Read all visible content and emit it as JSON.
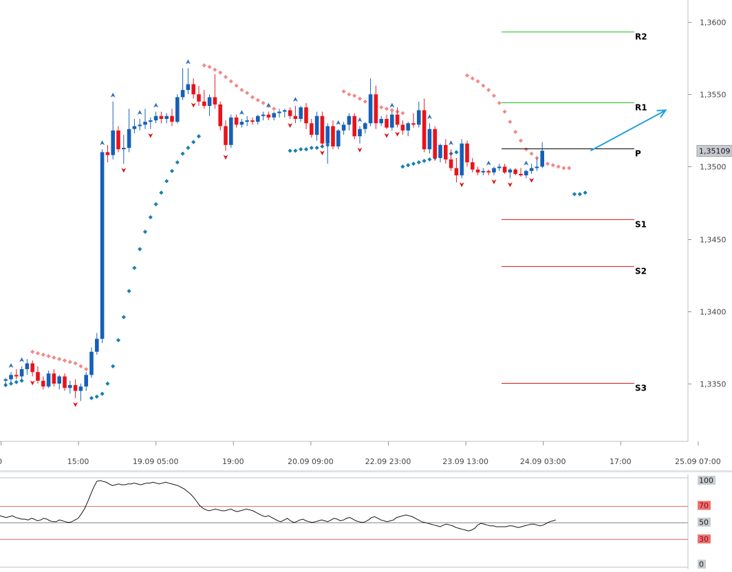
{
  "chart_data": [
    {
      "type": "candlestick",
      "x_ticks": [
        "0",
        "15:00",
        "19.09 05:00",
        "19:00",
        "20.09 09:00",
        "22.09 23:00",
        "23.09 13:00",
        "24.09 03:00",
        "17:00",
        "25.09 07:00"
      ],
      "y_ticks": [
        "1,3350",
        "1,3400",
        "1,3450",
        "1,3500",
        "1,3550",
        "1,3600"
      ],
      "ylim": [
        1.3318,
        1.3615
      ],
      "current_price": 1.35109,
      "current_price_label": "1,35109",
      "colors": {
        "bull": "#1560b8",
        "bear": "#e8141c",
        "sar_above": "#f08a8a",
        "sar_below": "#1a7fb0",
        "projection": "#1ea0dc"
      },
      "candles": [
        [
          1.3352,
          1.3354,
          1.3348,
          1.3353
        ],
        [
          1.3353,
          1.3358,
          1.3351,
          1.3356
        ],
        [
          1.3356,
          1.336,
          1.3353,
          1.3355
        ],
        [
          1.3355,
          1.3362,
          1.3352,
          1.336
        ],
        [
          1.336,
          1.3367,
          1.3356,
          1.3364
        ],
        [
          1.3364,
          1.3366,
          1.3355,
          1.3358
        ],
        [
          1.3358,
          1.3362,
          1.335,
          1.3352
        ],
        [
          1.3352,
          1.3355,
          1.3346,
          1.3348
        ],
        [
          1.3348,
          1.3359,
          1.3347,
          1.3357
        ],
        [
          1.3357,
          1.336,
          1.3348,
          1.335
        ],
        [
          1.335,
          1.3356,
          1.3346,
          1.3355
        ],
        [
          1.3355,
          1.3357,
          1.3345,
          1.3347
        ],
        [
          1.3347,
          1.3352,
          1.3343,
          1.3349
        ],
        [
          1.3349,
          1.3353,
          1.334,
          1.3345
        ],
        [
          1.3345,
          1.335,
          1.3338,
          1.3348
        ],
        [
          1.3348,
          1.3358,
          1.3345,
          1.3356
        ],
        [
          1.3356,
          1.3375,
          1.3354,
          1.3372
        ],
        [
          1.3372,
          1.3385,
          1.337,
          1.3381
        ],
        [
          1.3381,
          1.3512,
          1.3378,
          1.351
        ],
        [
          1.351,
          1.3515,
          1.3503,
          1.3508
        ],
        [
          1.3508,
          1.3545,
          1.3505,
          1.3525
        ],
        [
          1.3525,
          1.3528,
          1.351,
          1.3512
        ],
        [
          1.3512,
          1.3522,
          1.3502,
          1.3513
        ],
        [
          1.3513,
          1.354,
          1.351,
          1.3526
        ],
        [
          1.3526,
          1.3533,
          1.3523,
          1.3528
        ],
        [
          1.3528,
          1.3533,
          1.3525,
          1.3529
        ],
        [
          1.3529,
          1.354,
          1.3526,
          1.3531
        ],
        [
          1.3531,
          1.3534,
          1.3526,
          1.3532
        ],
        [
          1.3532,
          1.3538,
          1.353,
          1.3535
        ],
        [
          1.3535,
          1.3538,
          1.353,
          1.3533
        ],
        [
          1.3533,
          1.3537,
          1.353,
          1.3535
        ],
        [
          1.3535,
          1.354,
          1.3528,
          1.3531
        ],
        [
          1.3531,
          1.355,
          1.353,
          1.3548
        ],
        [
          1.3548,
          1.3568,
          1.3546,
          1.3553
        ],
        [
          1.3553,
          1.3568,
          1.355,
          1.3557
        ],
        [
          1.3557,
          1.3561,
          1.3547,
          1.355
        ],
        [
          1.355,
          1.3556,
          1.3542,
          1.3545
        ],
        [
          1.3545,
          1.3553,
          1.354,
          1.3542
        ],
        [
          1.3542,
          1.355,
          1.3535,
          1.3548
        ],
        [
          1.3548,
          1.3564,
          1.354,
          1.3543
        ],
        [
          1.3543,
          1.3545,
          1.3525,
          1.3528
        ],
        [
          1.3528,
          1.3532,
          1.3511,
          1.3515
        ],
        [
          1.3515,
          1.3536,
          1.3513,
          1.3534
        ],
        [
          1.3534,
          1.3536,
          1.3527,
          1.3529
        ],
        [
          1.3529,
          1.3533,
          1.3527,
          1.3531
        ],
        [
          1.3531,
          1.3535,
          1.3528,
          1.3532
        ],
        [
          1.3532,
          1.3534,
          1.3529,
          1.3531
        ],
        [
          1.3531,
          1.3536,
          1.3529,
          1.3535
        ],
        [
          1.3535,
          1.3538,
          1.3532,
          1.3536
        ],
        [
          1.3536,
          1.3538,
          1.3532,
          1.3534
        ],
        [
          1.3534,
          1.3538,
          1.3532,
          1.3537
        ],
        [
          1.3537,
          1.354,
          1.3534,
          1.3538
        ],
        [
          1.3538,
          1.354,
          1.3534,
          1.3539
        ],
        [
          1.3539,
          1.3541,
          1.3533,
          1.3535
        ],
        [
          1.3535,
          1.3542,
          1.353,
          1.3533
        ],
        [
          1.3533,
          1.3542,
          1.3531,
          1.3541
        ],
        [
          1.3541,
          1.3544,
          1.3526,
          1.353
        ],
        [
          1.353,
          1.3533,
          1.352,
          1.3522
        ],
        [
          1.3522,
          1.3538,
          1.3518,
          1.3535
        ],
        [
          1.3535,
          1.3538,
          1.3514,
          1.3516
        ],
        [
          1.3516,
          1.353,
          1.3502,
          1.3528
        ],
        [
          1.3528,
          1.3532,
          1.3512,
          1.3514
        ],
        [
          1.3514,
          1.3526,
          1.3512,
          1.3525
        ],
        [
          1.3525,
          1.3531,
          1.3522,
          1.3529
        ],
        [
          1.3529,
          1.3537,
          1.3525,
          1.3535
        ],
        [
          1.3535,
          1.3537,
          1.3519,
          1.3521
        ],
        [
          1.3521,
          1.3528,
          1.3516,
          1.3526
        ],
        [
          1.3526,
          1.3531,
          1.3523,
          1.353
        ],
        [
          1.353,
          1.3561,
          1.3528,
          1.355
        ],
        [
          1.355,
          1.3556,
          1.3526,
          1.353
        ],
        [
          1.353,
          1.3535,
          1.3528,
          1.3533
        ],
        [
          1.3533,
          1.3536,
          1.3526,
          1.3527
        ],
        [
          1.3527,
          1.3538,
          1.3525,
          1.3536
        ],
        [
          1.3536,
          1.3541,
          1.3527,
          1.3529
        ],
        [
          1.3529,
          1.3532,
          1.3522,
          1.3525
        ],
        [
          1.3525,
          1.3531,
          1.3521,
          1.353
        ],
        [
          1.353,
          1.3537,
          1.3527,
          1.3529
        ],
        [
          1.3529,
          1.3545,
          1.3527,
          1.3539
        ],
        [
          1.3539,
          1.3547,
          1.351,
          1.3512
        ],
        [
          1.3512,
          1.353,
          1.3509,
          1.3526
        ],
        [
          1.3526,
          1.3528,
          1.3504,
          1.3506
        ],
        [
          1.3506,
          1.3516,
          1.3503,
          1.3515
        ],
        [
          1.3515,
          1.3519,
          1.3502,
          1.3505
        ],
        [
          1.3505,
          1.3512,
          1.3497,
          1.3499
        ],
        [
          1.3499,
          1.3506,
          1.3489,
          1.3494
        ],
        [
          1.3494,
          1.3519,
          1.3492,
          1.3516
        ],
        [
          1.3516,
          1.3518,
          1.35,
          1.3503
        ],
        [
          1.3503,
          1.3506,
          1.3496,
          1.3498
        ],
        [
          1.3498,
          1.35,
          1.3494,
          1.3496
        ],
        [
          1.3496,
          1.3499,
          1.3494,
          1.3497
        ],
        [
          1.3497,
          1.3498,
          1.3494,
          1.3496
        ],
        [
          1.3496,
          1.35,
          1.3494,
          1.3499
        ],
        [
          1.3499,
          1.3502,
          1.3497,
          1.35
        ],
        [
          1.35,
          1.3502,
          1.3495,
          1.3496
        ],
        [
          1.3496,
          1.3499,
          1.3492,
          1.3498
        ],
        [
          1.3498,
          1.3499,
          1.3494,
          1.3495
        ],
        [
          1.3495,
          1.3499,
          1.3493,
          1.3494
        ],
        [
          1.3494,
          1.3498,
          1.3492,
          1.3497
        ],
        [
          1.3497,
          1.3502,
          1.3495,
          1.3499
        ],
        [
          1.3499,
          1.3506,
          1.3497,
          1.35
        ],
        [
          1.35,
          1.3517,
          1.3499,
          1.3511
        ]
      ],
      "sar_above": [
        [
          1,
          1.3355
        ],
        [
          5,
          1.3372
        ],
        [
          6,
          1.3371
        ],
        [
          7,
          1.337
        ],
        [
          8,
          1.3369
        ],
        [
          9,
          1.3368
        ],
        [
          10,
          1.3367
        ],
        [
          11,
          1.3366
        ],
        [
          12,
          1.3365
        ],
        [
          13,
          1.3364
        ],
        [
          14,
          1.3362
        ],
        [
          15,
          1.336
        ],
        [
          37,
          1.357
        ],
        [
          38,
          1.3569
        ],
        [
          39,
          1.3567
        ],
        [
          40,
          1.3565
        ],
        [
          41,
          1.3562
        ],
        [
          42,
          1.3559
        ],
        [
          43,
          1.3556
        ],
        [
          44,
          1.3553
        ],
        [
          45,
          1.3551
        ],
        [
          46,
          1.3548
        ],
        [
          47,
          1.3546
        ],
        [
          48,
          1.3544
        ],
        [
          49,
          1.3542
        ],
        [
          50,
          1.354
        ],
        [
          63,
          1.3552
        ],
        [
          64,
          1.355
        ],
        [
          65,
          1.3549
        ],
        [
          66,
          1.3547
        ],
        [
          67,
          1.3545
        ],
        [
          68,
          1.3543
        ],
        [
          69,
          1.3542
        ],
        [
          70,
          1.3541
        ],
        [
          71,
          1.354
        ],
        [
          72,
          1.3539
        ],
        [
          73,
          1.3538
        ],
        [
          74,
          1.3537
        ],
        [
          86,
          1.3563
        ],
        [
          87,
          1.3561
        ],
        [
          88,
          1.3559
        ],
        [
          89,
          1.3556
        ],
        [
          90,
          1.3553
        ],
        [
          91,
          1.3549
        ],
        [
          92,
          1.3544
        ],
        [
          93,
          1.3538
        ],
        [
          94,
          1.3531
        ],
        [
          95,
          1.3524
        ],
        [
          96,
          1.3518
        ],
        [
          97,
          1.3512
        ],
        [
          98,
          1.3509
        ],
        [
          99,
          1.3506
        ],
        [
          100,
          1.3504
        ],
        [
          101,
          1.3502
        ],
        [
          102,
          1.3501
        ],
        [
          103,
          1.35
        ],
        [
          104,
          1.3499
        ],
        [
          105,
          1.3499
        ]
      ],
      "sar_below": [
        [
          0,
          1.3349
        ],
        [
          1,
          1.335
        ],
        [
          2,
          1.3351
        ],
        [
          3,
          1.3352
        ],
        [
          16,
          1.334
        ],
        [
          17,
          1.3341
        ],
        [
          18,
          1.3343
        ],
        [
          19,
          1.335
        ],
        [
          20,
          1.3362
        ],
        [
          21,
          1.338
        ],
        [
          22,
          1.3396
        ],
        [
          23,
          1.3414
        ],
        [
          24,
          1.343
        ],
        [
          25,
          1.3443
        ],
        [
          26,
          1.3455
        ],
        [
          27,
          1.3465
        ],
        [
          28,
          1.3474
        ],
        [
          29,
          1.3482
        ],
        [
          30,
          1.349
        ],
        [
          31,
          1.3497
        ],
        [
          32,
          1.3503
        ],
        [
          33,
          1.3509
        ],
        [
          34,
          1.3513
        ],
        [
          35,
          1.3517
        ],
        [
          36,
          1.3521
        ],
        [
          53,
          1.3511
        ],
        [
          54,
          1.3511
        ],
        [
          55,
          1.3512
        ],
        [
          56,
          1.3512
        ],
        [
          57,
          1.3513
        ],
        [
          58,
          1.3513
        ],
        [
          59,
          1.3514
        ],
        [
          60,
          1.3515
        ],
        [
          61,
          1.3516
        ],
        [
          62,
          1.3517
        ],
        [
          74,
          1.35
        ],
        [
          75,
          1.3501
        ],
        [
          76,
          1.3502
        ],
        [
          77,
          1.3503
        ],
        [
          78,
          1.3504
        ],
        [
          79,
          1.3505
        ],
        [
          80,
          1.3506
        ],
        [
          81,
          1.3507
        ],
        [
          82,
          1.3508
        ],
        [
          83,
          1.3509
        ],
        [
          84,
          1.351
        ],
        [
          85,
          1.3511
        ],
        [
          106,
          1.3481
        ],
        [
          107,
          1.3481
        ],
        [
          108,
          1.3482
        ]
      ],
      "fractal_up": [
        1,
        3,
        18,
        20,
        25,
        28,
        34,
        44,
        49,
        54,
        62,
        66,
        72,
        79,
        83,
        90,
        97
      ],
      "fractal_down": [
        5,
        13,
        22,
        27,
        35,
        41,
        53,
        59,
        66,
        71,
        73,
        85,
        91,
        94,
        98,
        102,
        106
      ],
      "pivot_levels": [
        {
          "label": "R2",
          "value": 1.35935,
          "color": "#22bb22"
        },
        {
          "label": "R1",
          "value": 1.35445,
          "color": "#22bb22"
        },
        {
          "label": "P",
          "value": 1.35125,
          "color": "#000000"
        },
        {
          "label": "S1",
          "value": 1.34635,
          "color": "#e02020"
        },
        {
          "label": "S2",
          "value": 1.34315,
          "color": "#e02020"
        },
        {
          "label": "S3",
          "value": 1.33505,
          "color": "#c81818"
        }
      ],
      "projection": {
        "from_candle": 109,
        "from_value": 1.3511,
        "to_candle": 123,
        "to_value": 1.3539
      }
    },
    {
      "type": "line",
      "y_ticks": [
        "100",
        "70",
        "50",
        "30",
        "0"
      ],
      "levels": [
        70,
        50,
        30
      ],
      "ylim": [
        0,
        100
      ],
      "values": [
        58,
        57,
        56,
        57,
        58,
        56,
        55,
        54,
        54,
        53,
        55,
        54,
        52,
        53,
        55,
        54,
        52,
        51,
        51,
        53,
        52,
        51,
        50,
        51,
        53,
        55,
        60,
        66,
        74,
        83,
        92,
        99,
        100,
        99,
        98,
        96,
        94,
        95,
        96,
        95,
        95,
        96,
        96,
        97,
        96,
        95,
        96,
        97,
        97,
        98,
        97,
        96,
        97,
        98,
        97,
        96,
        95,
        94,
        92,
        90,
        87,
        84,
        80,
        75,
        70,
        67,
        65,
        64,
        65,
        66,
        65,
        64,
        64,
        65,
        66,
        64,
        63,
        64,
        65,
        66,
        65,
        64,
        62,
        60,
        58,
        57,
        58,
        56,
        54,
        52,
        51,
        53,
        55,
        52,
        50,
        51,
        53,
        54,
        52,
        51,
        50,
        51,
        52,
        53,
        52,
        51,
        53,
        55,
        54,
        52,
        53,
        55,
        56,
        54,
        52,
        51,
        50,
        51,
        53,
        56,
        57,
        55,
        53,
        52,
        51,
        52,
        53,
        56,
        57,
        58,
        59,
        58,
        57,
        55,
        53,
        51,
        50,
        49,
        48,
        47,
        46,
        45,
        47,
        48,
        47,
        46,
        44,
        43,
        42,
        41,
        40,
        41,
        43,
        47,
        49,
        48,
        47,
        46,
        46,
        45,
        45,
        45,
        45,
        46,
        46,
        45,
        44,
        45,
        46,
        47,
        48,
        48,
        47,
        46,
        47,
        49,
        51,
        52,
        53
      ]
    }
  ]
}
